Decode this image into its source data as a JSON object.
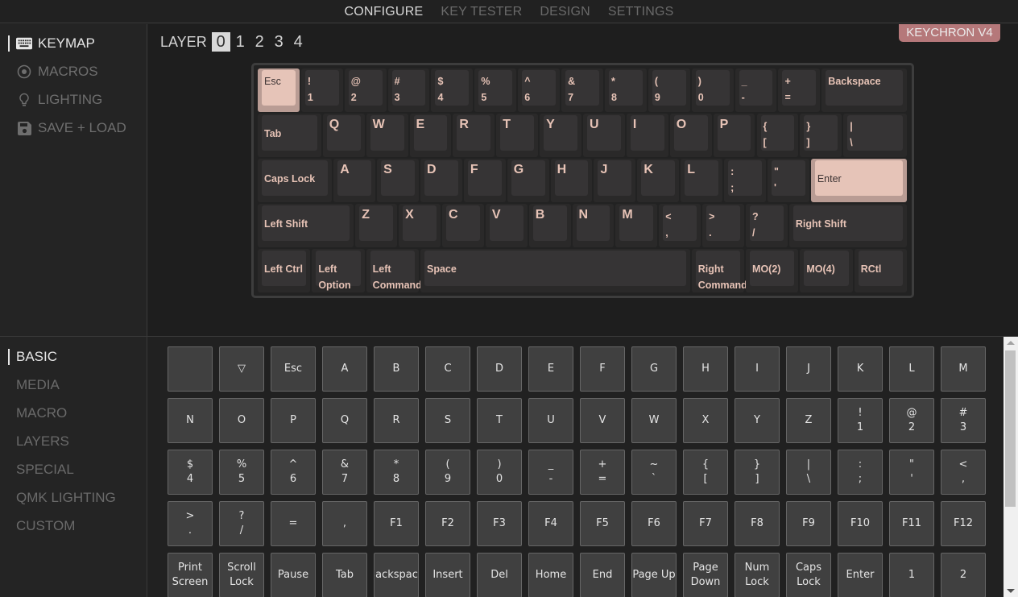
{
  "topnav": {
    "tabs": [
      {
        "label": "CONFIGURE",
        "active": true
      },
      {
        "label": "KEY TESTER",
        "active": false
      },
      {
        "label": "DESIGN",
        "active": false
      },
      {
        "label": "SETTINGS",
        "active": false
      }
    ]
  },
  "sidebar": {
    "items": [
      {
        "label": "KEYMAP",
        "icon": "keyboard-icon",
        "active": true
      },
      {
        "label": "MACROS",
        "icon": "record-icon",
        "active": false
      },
      {
        "label": "LIGHTING",
        "icon": "lightbulb-icon",
        "active": false
      },
      {
        "label": "SAVE + LOAD",
        "icon": "floppy-disk-icon",
        "active": false
      }
    ]
  },
  "layer": {
    "label": "LAYER",
    "options": [
      "0",
      "1",
      "2",
      "3",
      "4"
    ],
    "selected": "0"
  },
  "device": {
    "name": "KEYCHRON V4",
    "badge_color": "#b5787a"
  },
  "colors": {
    "legend": "#e7c3b6",
    "highlight_cap": "#e6c4b8",
    "key_shell": "#2a2929",
    "key_cap": "#363435"
  },
  "keyboard": {
    "rows": [
      [
        {
          "top": "Esc",
          "w": 1,
          "hl": true
        },
        {
          "top": "!",
          "bottom": "1",
          "w": 1
        },
        {
          "top": "@",
          "bottom": "2",
          "w": 1
        },
        {
          "top": "#",
          "bottom": "3",
          "w": 1
        },
        {
          "top": "$",
          "bottom": "4",
          "w": 1
        },
        {
          "top": "%",
          "bottom": "5",
          "w": 1
        },
        {
          "top": "^",
          "bottom": "6",
          "w": 1
        },
        {
          "top": "&",
          "bottom": "7",
          "w": 1
        },
        {
          "top": "*",
          "bottom": "8",
          "w": 1
        },
        {
          "top": "(",
          "bottom": "9",
          "w": 1
        },
        {
          "top": ")",
          "bottom": "0",
          "w": 1
        },
        {
          "top": "_",
          "bottom": "-",
          "w": 1
        },
        {
          "top": "+",
          "bottom": "=",
          "w": 1
        },
        {
          "top": "Backspace",
          "w": 2
        }
      ],
      [
        {
          "top": "Tab",
          "w": 1.5,
          "mid": true
        },
        {
          "top": "Q",
          "w": 1,
          "big": true
        },
        {
          "top": "W",
          "w": 1,
          "big": true
        },
        {
          "top": "E",
          "w": 1,
          "big": true
        },
        {
          "top": "R",
          "w": 1,
          "big": true
        },
        {
          "top": "T",
          "w": 1,
          "big": true
        },
        {
          "top": "Y",
          "w": 1,
          "big": true
        },
        {
          "top": "U",
          "w": 1,
          "big": true
        },
        {
          "top": "I",
          "w": 1,
          "big": true
        },
        {
          "top": "O",
          "w": 1,
          "big": true
        },
        {
          "top": "P",
          "w": 1,
          "big": true
        },
        {
          "top": "{",
          "bottom": "[",
          "w": 1
        },
        {
          "top": "}",
          "bottom": "]",
          "w": 1
        },
        {
          "top": "|",
          "bottom": "\\",
          "w": 1.5
        }
      ],
      [
        {
          "top": "Caps Lock",
          "w": 1.75,
          "mid": true
        },
        {
          "top": "A",
          "w": 1,
          "big": true
        },
        {
          "top": "S",
          "w": 1,
          "big": true
        },
        {
          "top": "D",
          "w": 1,
          "big": true
        },
        {
          "top": "F",
          "w": 1,
          "big": true
        },
        {
          "top": "G",
          "w": 1,
          "big": true
        },
        {
          "top": "H",
          "w": 1,
          "big": true
        },
        {
          "top": "J",
          "w": 1,
          "big": true
        },
        {
          "top": "K",
          "w": 1,
          "big": true
        },
        {
          "top": "L",
          "w": 1,
          "big": true
        },
        {
          "top": ":",
          "bottom": ";",
          "w": 1
        },
        {
          "top": "\"",
          "bottom": "'",
          "w": 1
        },
        {
          "top": "Enter",
          "w": 2.25,
          "hl": true,
          "mid": true
        }
      ],
      [
        {
          "top": "Left Shift",
          "w": 2.25,
          "mid": true
        },
        {
          "top": "Z",
          "w": 1,
          "big": true
        },
        {
          "top": "X",
          "w": 1,
          "big": true
        },
        {
          "top": "C",
          "w": 1,
          "big": true
        },
        {
          "top": "V",
          "w": 1,
          "big": true
        },
        {
          "top": "B",
          "w": 1,
          "big": true
        },
        {
          "top": "N",
          "w": 1,
          "big": true
        },
        {
          "top": "M",
          "w": 1,
          "big": true
        },
        {
          "top": "<",
          "bottom": ",",
          "w": 1
        },
        {
          "top": ">",
          "bottom": ".",
          "w": 1
        },
        {
          "top": "?",
          "bottom": "/",
          "w": 1
        },
        {
          "top": "Right Shift",
          "w": 2.75,
          "mid": true
        }
      ],
      [
        {
          "top": "Left Ctrl",
          "w": 1.25,
          "mid": true
        },
        {
          "top": "Left",
          "bottom": "Option",
          "w": 1.25,
          "mid": true
        },
        {
          "top": "Left",
          "bottom": "Command",
          "w": 1.25,
          "mid": true
        },
        {
          "top": "Space",
          "w": 6.25,
          "mid": true
        },
        {
          "top": "Right",
          "bottom": "Command",
          "w": 1.25,
          "mid": true
        },
        {
          "top": "MO(2)",
          "w": 1.25,
          "mid": true
        },
        {
          "top": "MO(4)",
          "w": 1.25,
          "mid": true
        },
        {
          "top": "RCtl",
          "w": 1.25,
          "mid": true
        }
      ]
    ]
  },
  "picker_nav": {
    "items": [
      {
        "label": "BASIC",
        "active": true
      },
      {
        "label": "MEDIA",
        "active": false
      },
      {
        "label": "MACRO",
        "active": false
      },
      {
        "label": "LAYERS",
        "active": false
      },
      {
        "label": "SPECIAL",
        "active": false
      },
      {
        "label": "QMK LIGHTING",
        "active": false
      },
      {
        "label": "CUSTOM",
        "active": false
      }
    ]
  },
  "picker": {
    "keys": [
      [
        "",
        "▽",
        "Esc",
        "A",
        "B",
        "C",
        "D",
        "E",
        "F",
        "G",
        "H",
        "I",
        "J",
        "K",
        "L",
        "M"
      ],
      [
        "N",
        "O",
        "P",
        "Q",
        "R",
        "S",
        "T",
        "U",
        "V",
        "W",
        "X",
        "Y",
        "Z",
        "!\n1",
        "@\n2",
        "#\n3"
      ],
      [
        "$\n4",
        "%\n5",
        "^\n6",
        "&\n7",
        "*\n8",
        "(\n9",
        ")\n0",
        "_\n-",
        "+\n=",
        "~\n`",
        "{\n[",
        "}\n]",
        "|\n\\",
        ":\n;",
        "\"\n'",
        "<\n,"
      ],
      [
        ">\n.",
        "?\n/",
        "=",
        ",",
        "F1",
        "F2",
        "F3",
        "F4",
        "F5",
        "F6",
        "F7",
        "F8",
        "F9",
        "F10",
        "F11",
        "F12"
      ],
      [
        "Print\nScreen",
        "Scroll\nLock",
        "Pause",
        "Tab",
        "Backspace",
        "Insert",
        "Del",
        "Home",
        "End",
        "Page Up",
        "Page\nDown",
        "Num\nLock",
        "Caps\nLock",
        "Enter",
        "1",
        "2"
      ]
    ]
  }
}
